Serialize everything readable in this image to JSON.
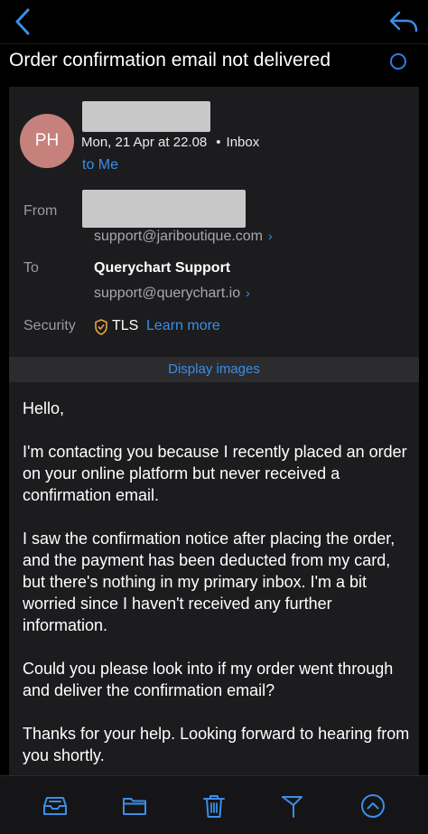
{
  "colors": {
    "accent": "#3b8ee6",
    "avatar_bg": "#c7817c",
    "shield": "#e8a13a"
  },
  "nav": {
    "back_icon": "chevron-left-icon",
    "reply_icon": "reply-icon"
  },
  "subject": "Order confirmation email not delivered",
  "header": {
    "avatar_initials": "PH",
    "date": "Mon, 21 Apr at 22.08",
    "separator": "•",
    "folder": "Inbox",
    "to_me": "to Me"
  },
  "details": {
    "from_label": "From",
    "from_address": "support@jariboutique.com",
    "to_label": "To",
    "to_name": "Querychart Support",
    "to_address": "support@querychart.io",
    "security_label": "Security",
    "security_value": "TLS",
    "learn_more": "Learn more",
    "chevron": "›"
  },
  "display_images": "Display images",
  "body": {
    "paragraphs": [
      "Hello,",
      "I'm contacting you because I recently placed an order on your online platform but never received a confirmation email.",
      "I saw the confirmation notice after placing the order, and the payment has been deducted from my card, but there's nothing in my primary inbox. I'm a bit worried since I haven't received any further information.",
      "Could you please look into if my order went through and deliver the confirmation email?",
      "Thanks for your help. Looking forward to hearing from you shortly."
    ]
  },
  "toolbar": {
    "icons": [
      "archive-icon",
      "folder-icon",
      "trash-icon",
      "flag-icon",
      "chevron-up-icon"
    ]
  }
}
